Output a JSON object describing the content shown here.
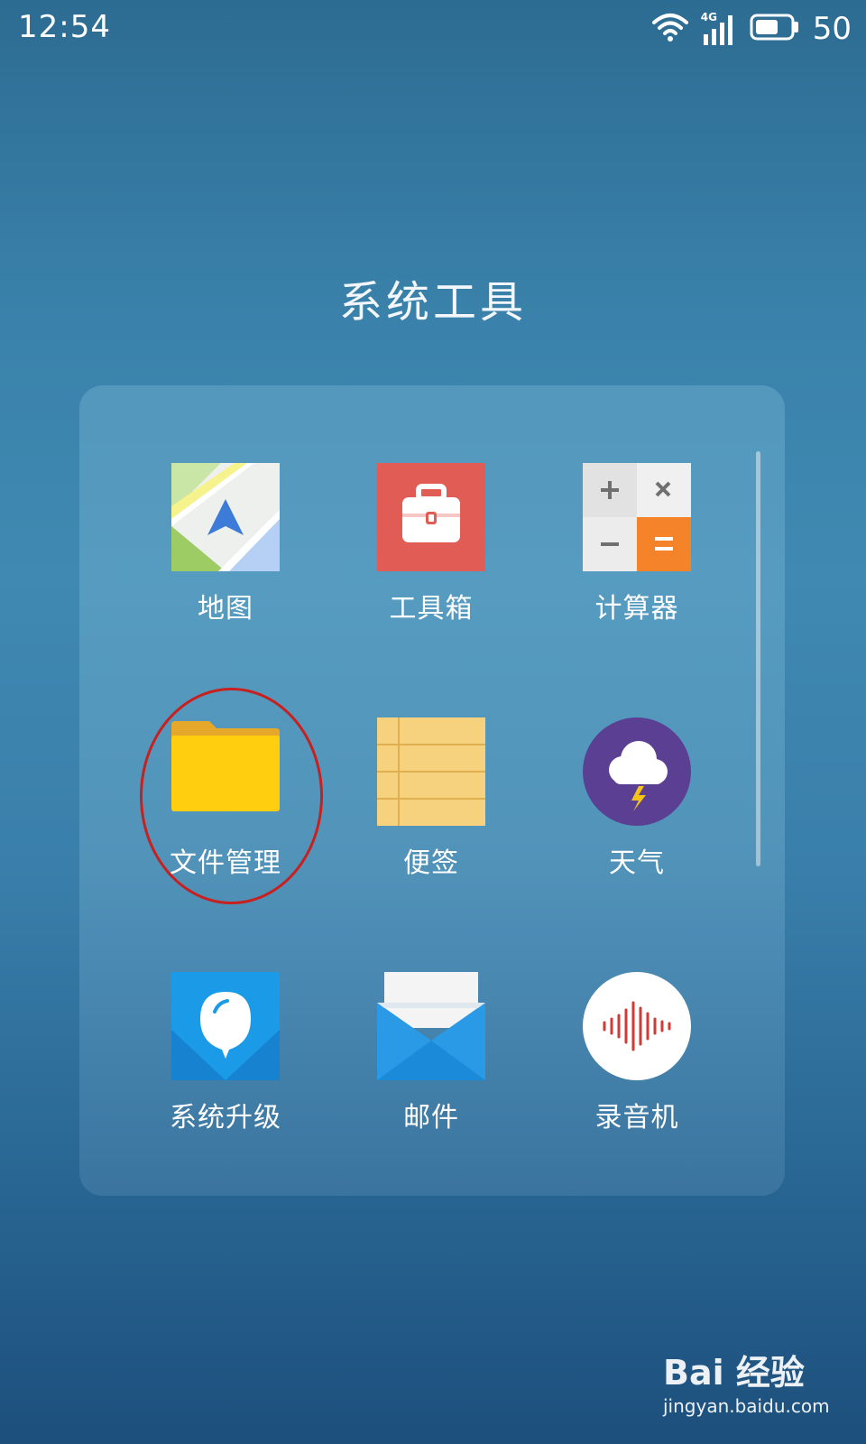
{
  "status_bar": {
    "time": "12:54",
    "network": "4G",
    "battery": "50"
  },
  "folder": {
    "title": "系统工具",
    "apps": [
      {
        "label": "地图",
        "icon": "map-icon"
      },
      {
        "label": "工具箱",
        "icon": "toolbox-icon"
      },
      {
        "label": "计算器",
        "icon": "calculator-icon"
      },
      {
        "label": "文件管理",
        "icon": "folder-icon"
      },
      {
        "label": "便签",
        "icon": "notepad-icon"
      },
      {
        "label": "天气",
        "icon": "weather-icon"
      },
      {
        "label": "系统升级",
        "icon": "system-update-icon"
      },
      {
        "label": "邮件",
        "icon": "mail-icon"
      },
      {
        "label": "录音机",
        "icon": "recorder-icon"
      }
    ]
  },
  "watermark": {
    "brand": "Bai 经验",
    "url": "jingyan.baidu.com"
  },
  "colors": {
    "annotation": "#c8201e",
    "accent_orange": "#f5832a",
    "toolbox_red": "#e05c55",
    "folder_yellow": "#ffcf0f",
    "weather_purple": "#5b3f93"
  }
}
